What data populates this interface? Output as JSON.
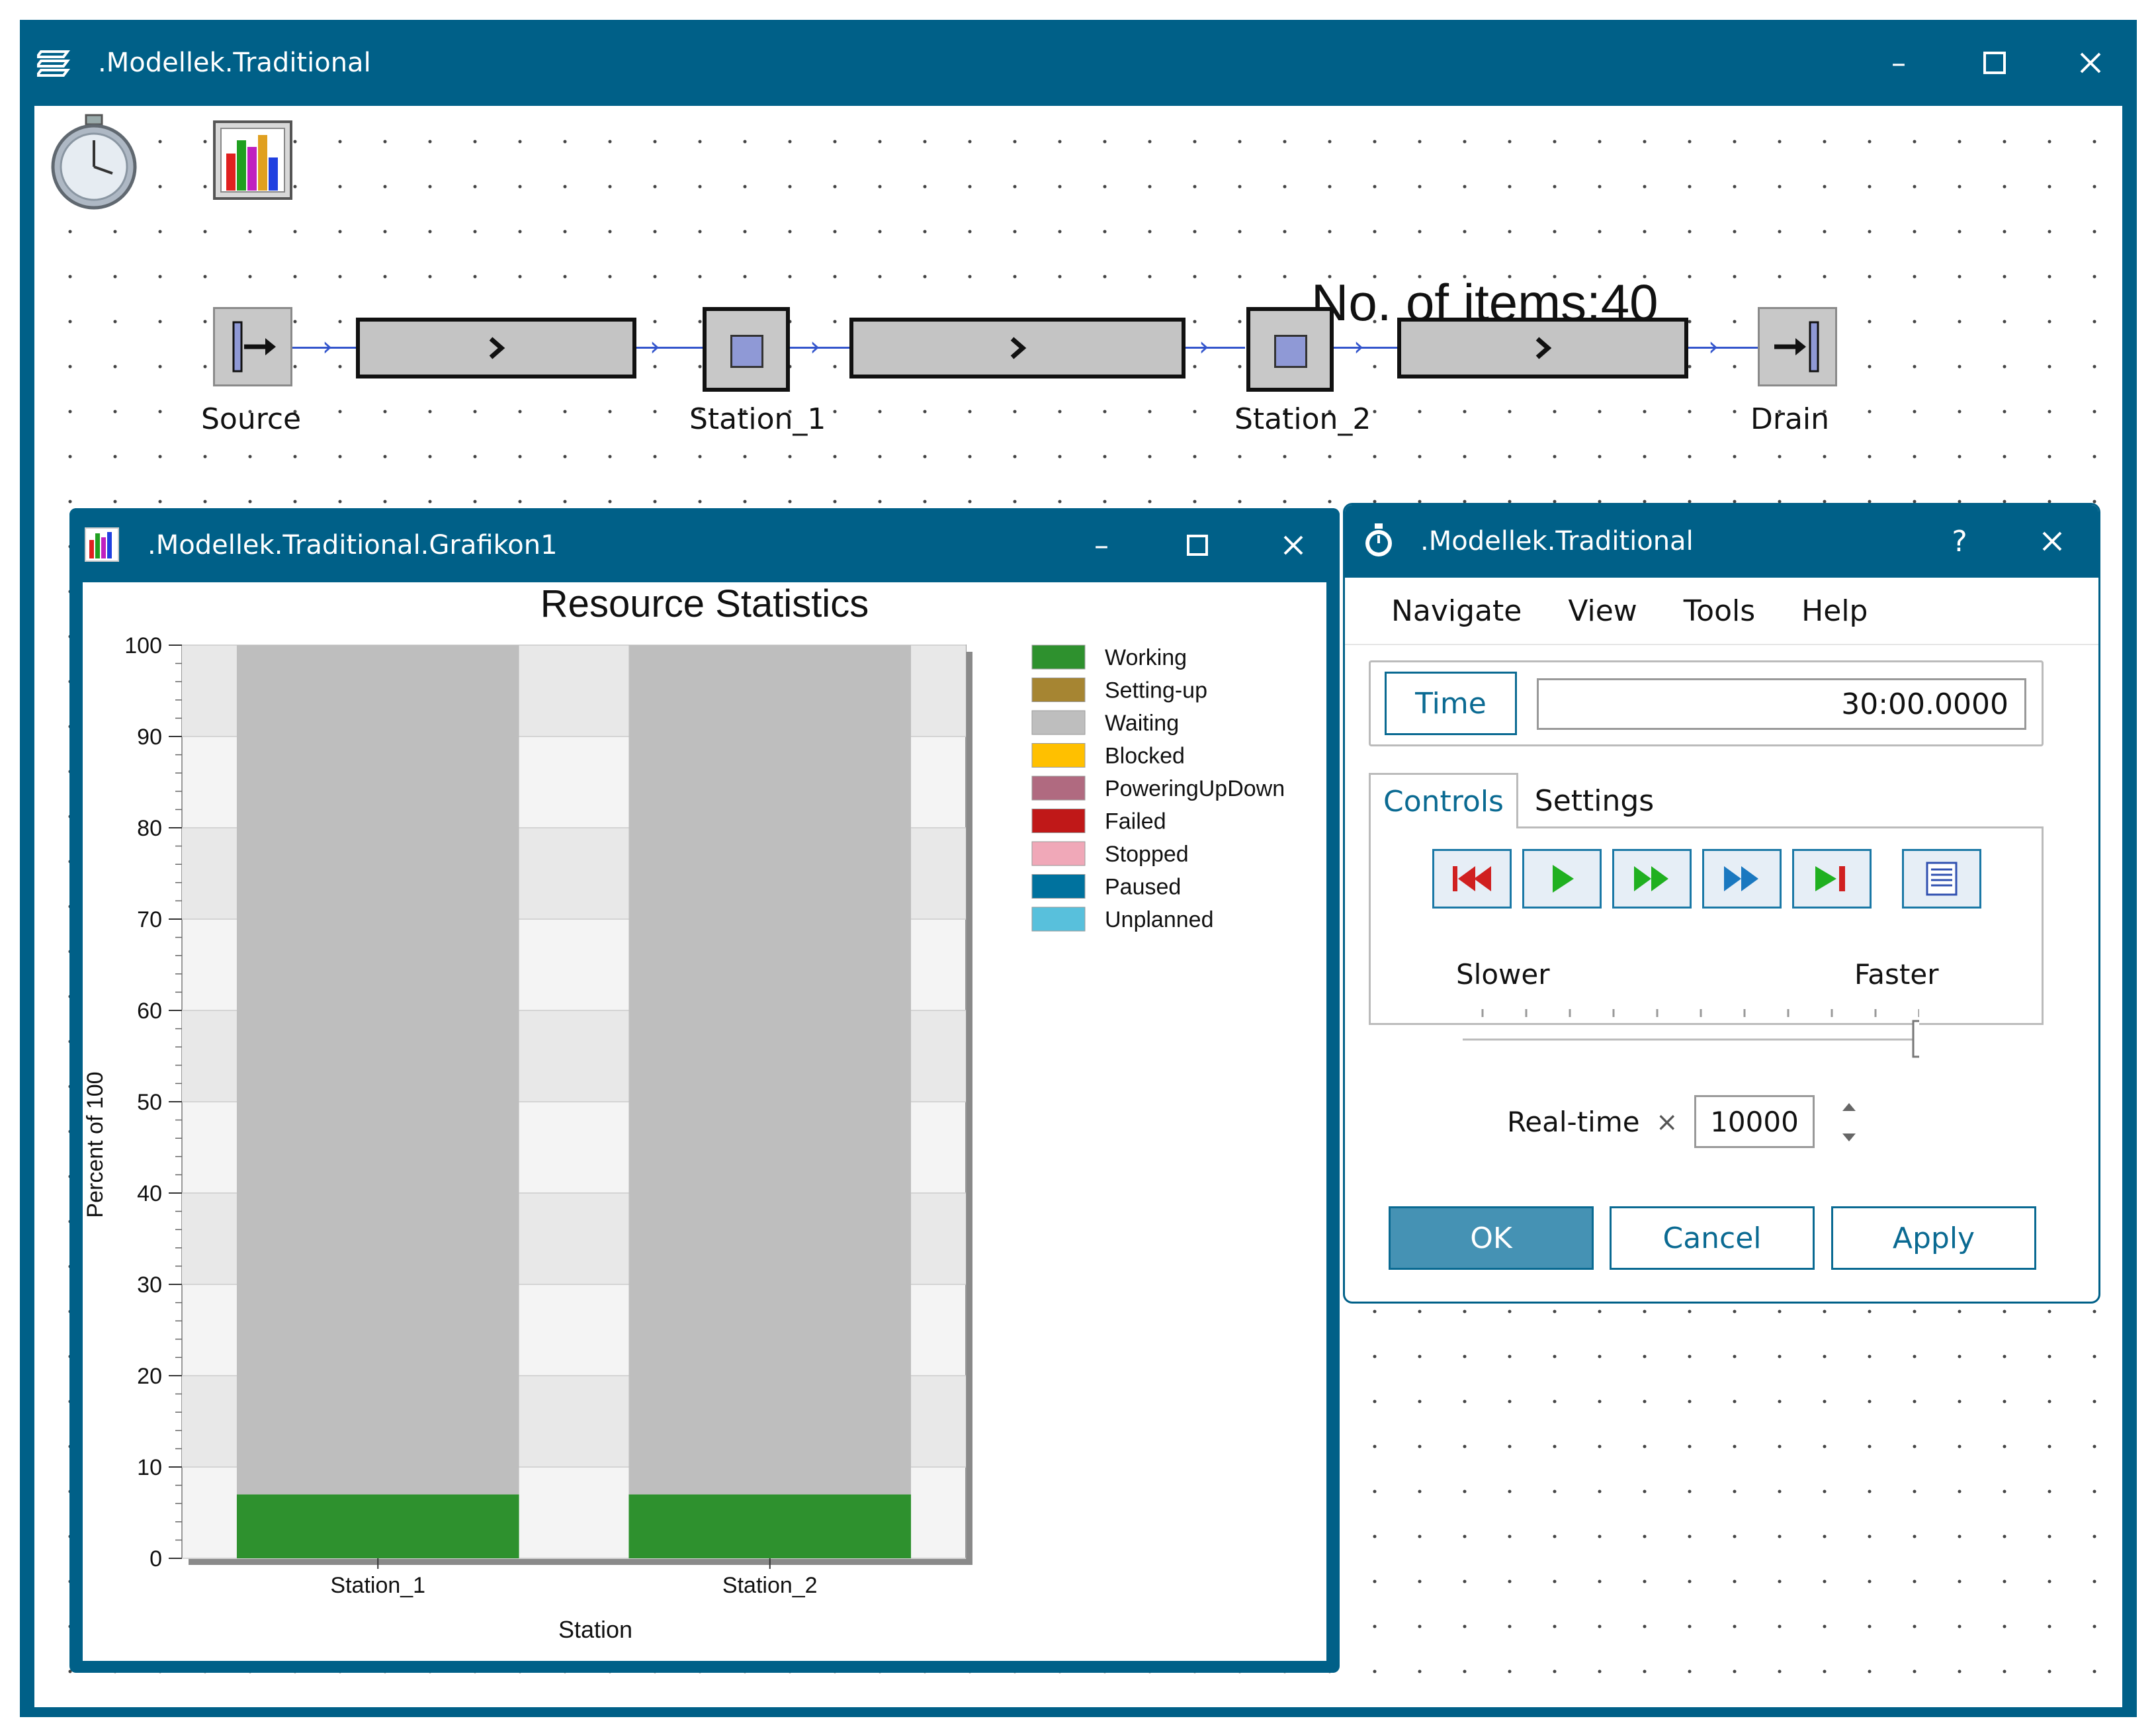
{
  "main_window": {
    "title": ".Modellek.Traditional",
    "item_count_text": "No. of items:40",
    "objects": {
      "source": "Source",
      "station1": "Station_1",
      "station2": "Station_2",
      "drain": "Drain"
    }
  },
  "chart_window": {
    "title": ".Modellek.Traditional.Grafikon1"
  },
  "sim_dialog": {
    "title": ".Modellek.Traditional",
    "help_glyph": "?",
    "menu": [
      "Navigate",
      "View",
      "Tools",
      "Help"
    ],
    "time_button": "Time",
    "time_value": "30:00.0000",
    "tabs": [
      "Controls",
      "Settings"
    ],
    "slower": "Slower",
    "faster": "Faster",
    "realtime_label": "Real-time",
    "multiplier_glyph": "×",
    "realtime_value": "10000",
    "buttons": {
      "ok": "OK",
      "cancel": "Cancel",
      "apply": "Apply"
    },
    "slider_value_fraction": 1.0
  },
  "colors": {
    "titlebar": "#006088",
    "working": "#2e912e",
    "setting_up": "#a68532",
    "waiting": "#bebebe",
    "blocked": "#ffc000",
    "powering": "#b06a80",
    "failed": "#c01818",
    "stopped": "#f0a8b8",
    "paused": "#00729e",
    "unplanned": "#58c0dc"
  },
  "chart_data": {
    "type": "bar",
    "title": "Resource Statistics",
    "xlabel": "Station",
    "ylabel": "Percent of 100",
    "categories": [
      "Station_1",
      "Station_2"
    ],
    "ylim": [
      0,
      100
    ],
    "yticks": [
      "0",
      "10",
      "20",
      "30",
      "40",
      "50",
      "60",
      "70",
      "80",
      "90",
      "100"
    ],
    "stacked": true,
    "legend_placement": "right",
    "series": [
      {
        "name": "Working",
        "color": "#2e912e",
        "values": [
          7,
          7
        ]
      },
      {
        "name": "Setting-up",
        "color": "#a68532",
        "values": [
          0,
          0
        ]
      },
      {
        "name": "Waiting",
        "color": "#bebebe",
        "values": [
          93,
          93
        ]
      },
      {
        "name": "Blocked",
        "color": "#ffc000",
        "values": [
          0,
          0
        ]
      },
      {
        "name": "PoweringUpDown",
        "color": "#b06a80",
        "values": [
          0,
          0
        ]
      },
      {
        "name": "Failed",
        "color": "#c01818",
        "values": [
          0,
          0
        ]
      },
      {
        "name": "Stopped",
        "color": "#f0a8b8",
        "values": [
          0,
          0
        ]
      },
      {
        "name": "Paused",
        "color": "#00729e",
        "values": [
          0,
          0
        ]
      },
      {
        "name": "Unplanned",
        "color": "#58c0dc",
        "values": [
          0,
          0
        ]
      }
    ]
  }
}
